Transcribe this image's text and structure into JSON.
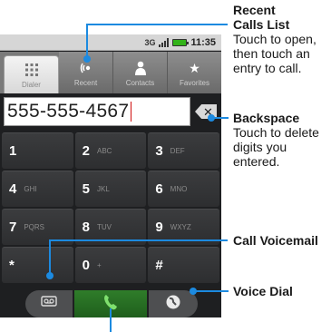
{
  "status_bar": {
    "network": "3G",
    "time": "11:35"
  },
  "tabs": [
    {
      "label": "Dialer",
      "icon": "keypad-grid-icon",
      "active": true
    },
    {
      "label": "Recent",
      "icon": "recent-calls-icon",
      "active": false
    },
    {
      "label": "Contacts",
      "icon": "person-icon",
      "active": false
    },
    {
      "label": "Favorites",
      "icon": "star-icon",
      "active": false
    }
  ],
  "dialer": {
    "number": "555-555-4567",
    "backspace_glyph": "✕"
  },
  "keypad": [
    {
      "num": "1",
      "letters": ""
    },
    {
      "num": "2",
      "letters": "ABC"
    },
    {
      "num": "3",
      "letters": "DEF"
    },
    {
      "num": "4",
      "letters": "GHI"
    },
    {
      "num": "5",
      "letters": "JKL"
    },
    {
      "num": "6",
      "letters": "MNO"
    },
    {
      "num": "7",
      "letters": "PQRS"
    },
    {
      "num": "8",
      "letters": "TUV"
    },
    {
      "num": "9",
      "letters": "WXYZ"
    },
    {
      "num": "*",
      "letters": ""
    },
    {
      "num": "0",
      "letters": "+"
    },
    {
      "num": "#",
      "letters": ""
    }
  ],
  "call_bar": {
    "voicemail_icon": "voicemail-icon",
    "call_icon": "phone-handset-icon",
    "voice_dial_icon": "voice-dial-icon"
  },
  "callouts": {
    "recent": {
      "title_line1": "Recent",
      "title_line2": "Calls List",
      "body": [
        "Touch to open,",
        "then touch an",
        "entry to call."
      ]
    },
    "backspace": {
      "title": "Backspace",
      "body": [
        "Touch to delete",
        "digits you",
        "entered."
      ]
    },
    "voicemail": {
      "title": "Call Voicemail"
    },
    "voice_dial": {
      "title": "Voice Dial"
    }
  },
  "colors": {
    "callout_accent": "#1c8ae0",
    "call_button": "#2f7d2a",
    "number_caret": "#d01010"
  }
}
